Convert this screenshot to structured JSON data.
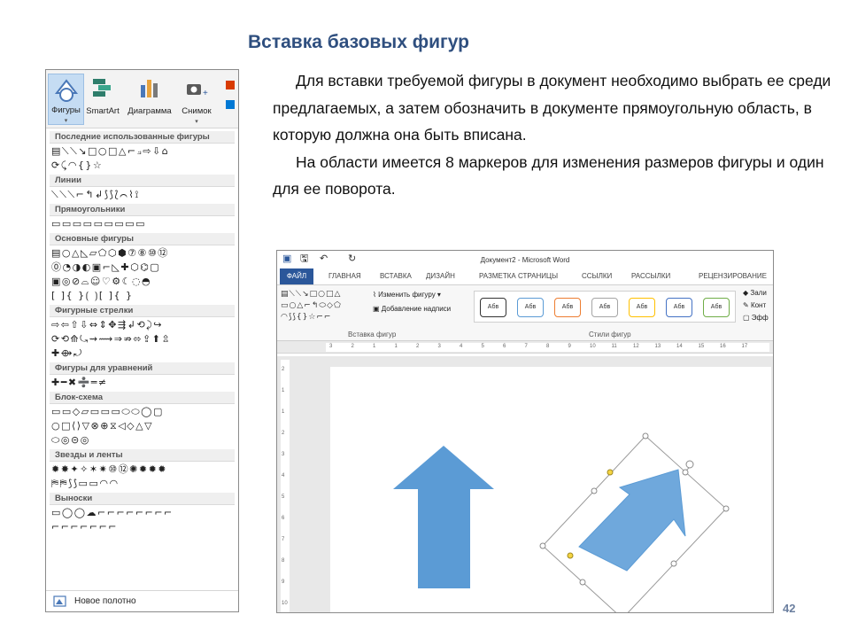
{
  "slide": {
    "title": "Вставка базовых фигур",
    "paragraph1": "Для вставки требуемой фигуры в документ необходимо выбрать ее среди предлагаемых, а затем обозначить в документе прямоугольную область, в которую должна она быть вписана.",
    "paragraph2": "На области имеется 8 маркеров для изменения размеров фигуры и один для ее поворота.",
    "page_number": "42"
  },
  "gallery": {
    "ribbon_buttons": [
      {
        "label": "Фигуры",
        "icon": "shapes-icon"
      },
      {
        "label": "SmartArt",
        "icon": "smartart-icon"
      },
      {
        "label": "Диаграмма",
        "icon": "chart-icon"
      },
      {
        "label": "Снимок",
        "icon": "screenshot-icon"
      }
    ],
    "sections": [
      {
        "label": "Последние использованные фигуры",
        "rows": [
          "▤⟍⟍↘□○□△⌐⟓⇨⇩⌂",
          "⟳⤹◠{}☆"
        ]
      },
      {
        "label": "Линии",
        "rows": [
          "⟍⟍⟍⌐↰↲⟆⟆⟅⌒⌇⟟"
        ]
      },
      {
        "label": "Прямоугольники",
        "rows": [
          "▭▭▭▭▭▭▭▭▭"
        ]
      },
      {
        "label": "Основные фигуры",
        "rows": [
          "▤○△◺▱⬠⬡⬢⑦⑧⑩⑫",
          "⓪◔◑◐▣⌐◺✚⬡⌬▢",
          "▣◎⊘⌓☺♡⚙☾◌◓",
          "[ ]{ }⟮ ⟯[ ]{ }"
        ]
      },
      {
        "label": "Фигурные стрелки",
        "rows": [
          "⇨⇦⇧⇩⇔⇕✥⇶↲⟲⤸↪",
          "⟳⟲⟰⤿⇝⟿⇒⇏⬄⇪⬆⇫",
          "✚⟴⤾"
        ]
      },
      {
        "label": "Фигуры для уравнений",
        "rows": [
          "✚━✖➗═≠"
        ]
      },
      {
        "label": "Блок-схема",
        "rows": [
          "▭▭◇▱▭▭▭⬭⬭◯▢",
          "○□⟨⟩▽⊗⊕⧖◁◇△▽",
          "⬭◎⊝◎"
        ]
      },
      {
        "label": "Звезды и ленты",
        "rows": [
          "✹✸✦✧✶✷⑩⑫✺✹✹✹",
          "⛿⛿⟆⟆▭▭◠◠"
        ]
      },
      {
        "label": "Выноски",
        "rows": [
          "▭◯◯☁⌐⌐⌐⌐⌐⌐⌐⌐",
          "⌐⌐⌐⌐⌐⌐⌐"
        ]
      }
    ],
    "new_canvas": "Новое полотно"
  },
  "word": {
    "doc_title": "Документ2 - Microsoft Word",
    "tabs": [
      "ФАЙЛ",
      "ГЛАВНАЯ",
      "ВСТАВКА",
      "ДИЗАЙН",
      "РАЗМЕТКА СТРАНИЦЫ",
      "ССЫЛКИ",
      "РАССЫЛКИ",
      "РЕЦЕНЗИРОВАНИЕ"
    ],
    "cmd_change_shape": "Изменить фигуру",
    "cmd_add_text": "Добавление надписи",
    "group_insert_shapes": "Вставка фигур",
    "group_shape_styles": "Стили фигур",
    "style_tiles": [
      "Абв",
      "Абв",
      "Абв",
      "Абв",
      "Абв",
      "Абв",
      "Абв"
    ],
    "right_cmds": [
      "Зали",
      "Конт",
      "Эфф"
    ],
    "ruler_numbers": [
      "3",
      "2",
      "1",
      "1",
      "2",
      "3",
      "4",
      "5",
      "6",
      "7",
      "8",
      "9",
      "10",
      "11",
      "12",
      "13",
      "14",
      "15",
      "16",
      "17"
    ],
    "vruler_numbers": [
      "2",
      "1",
      "1",
      "2",
      "3",
      "4",
      "5",
      "6",
      "7",
      "8",
      "9",
      "10"
    ]
  },
  "colors": {
    "accent": "#2b579a",
    "title": "#2f4f7f",
    "arrow_fill_up": "#5b9bd5",
    "arrow_fill_diag": "#6fa8dc",
    "style_borders": [
      "#333333",
      "#5b9bd5",
      "#ed7d31",
      "#a5a5a5",
      "#ffc000",
      "#4472c4",
      "#70ad47"
    ]
  }
}
